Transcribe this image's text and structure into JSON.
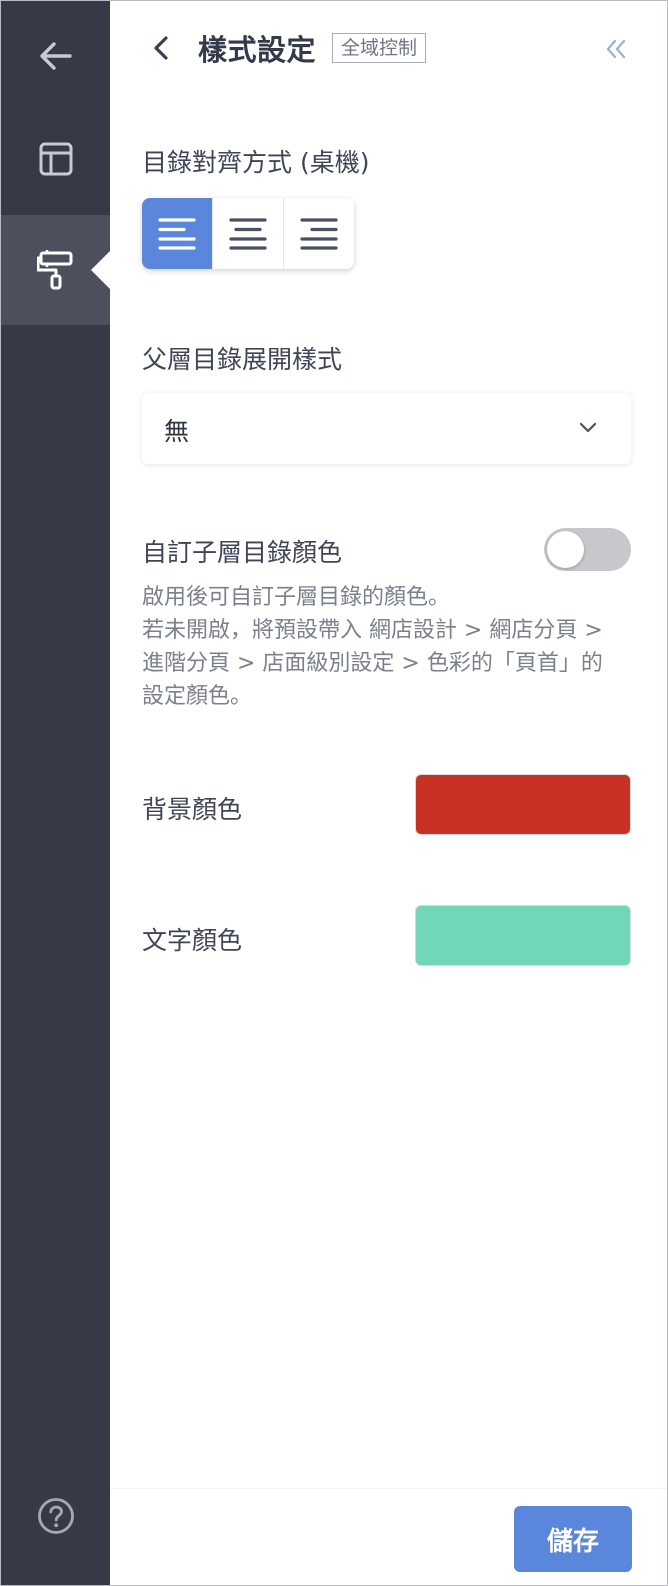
{
  "header": {
    "title": "樣式設定",
    "scope_badge": "全域控制"
  },
  "alignment": {
    "label": "目錄對齊方式 (桌機)",
    "options": [
      "left",
      "center",
      "right"
    ],
    "selected": "left"
  },
  "expand_style": {
    "label": "父層目錄展開樣式",
    "value": "無"
  },
  "custom_child_color": {
    "label": "自訂子層目錄顏色",
    "enabled": false,
    "description_lines": [
      "啟用後可自訂子層目錄的顏色。",
      "若未開啟，將預設帶入 網店設計 > 網店分頁 >",
      "進階分頁 > 店面級別設定 > 色彩的「頁首」的",
      "設定顏色。"
    ]
  },
  "background_color": {
    "label": "背景顏色",
    "color": "#c93125"
  },
  "text_color": {
    "label": "文字顏色",
    "color": "#72d6b8"
  },
  "footer": {
    "save_label": "儲存"
  },
  "icons": {
    "rail": [
      "arrow-left-icon",
      "layout-icon",
      "paint-roller-icon",
      "help-icon"
    ],
    "header": [
      "chevron-left-icon",
      "double-chevron-left-icon"
    ]
  },
  "colors": {
    "rail_bg": "#363a47",
    "accent": "#5a87dc"
  }
}
